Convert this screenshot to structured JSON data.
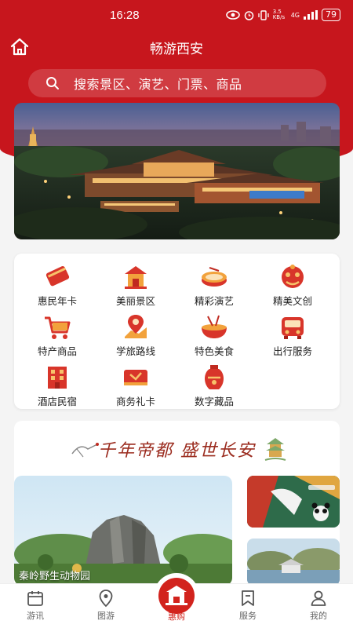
{
  "status_bar": {
    "time": "16:28",
    "signal_text": "4G",
    "speed": "3.5 KB/s",
    "battery": "79"
  },
  "header": {
    "title": "畅游西安",
    "search_placeholder": "搜索景区、演艺、门票、商品"
  },
  "services": [
    {
      "label": "惠民年卡",
      "icon": "red-card-icon"
    },
    {
      "label": "美丽景区",
      "icon": "pavilion-icon"
    },
    {
      "label": "精彩演艺",
      "icon": "stage-drum-icon"
    },
    {
      "label": "精美文创",
      "icon": "lion-mask-icon"
    },
    {
      "label": "特产商品",
      "icon": "shopping-cart-icon"
    },
    {
      "label": "学旅路线",
      "icon": "map-pin-icon"
    },
    {
      "label": "特色美食",
      "icon": "noodle-bowl-icon"
    },
    {
      "label": "出行服务",
      "icon": "bus-icon"
    },
    {
      "label": "酒店民宿",
      "icon": "hotel-building-icon"
    },
    {
      "label": "商务礼卡",
      "icon": "gift-card-icon"
    },
    {
      "label": "数字藏品",
      "icon": "vase-icon"
    }
  ],
  "promo": {
    "slogan": "千年帝都 盛世长安",
    "feature_caption": "秦岭野生动物园"
  },
  "bottom_nav": [
    {
      "label": "游讯",
      "icon": "calendar-icon"
    },
    {
      "label": "图游",
      "icon": "location-pin-icon"
    },
    {
      "label": "惠购",
      "icon": "city-gate-icon",
      "active": true
    },
    {
      "label": "服务",
      "icon": "bookmark-flag-icon"
    },
    {
      "label": "我的",
      "icon": "person-icon"
    }
  ],
  "colors": {
    "brand_red": "#c7161d",
    "active_red": "#d2231d"
  }
}
